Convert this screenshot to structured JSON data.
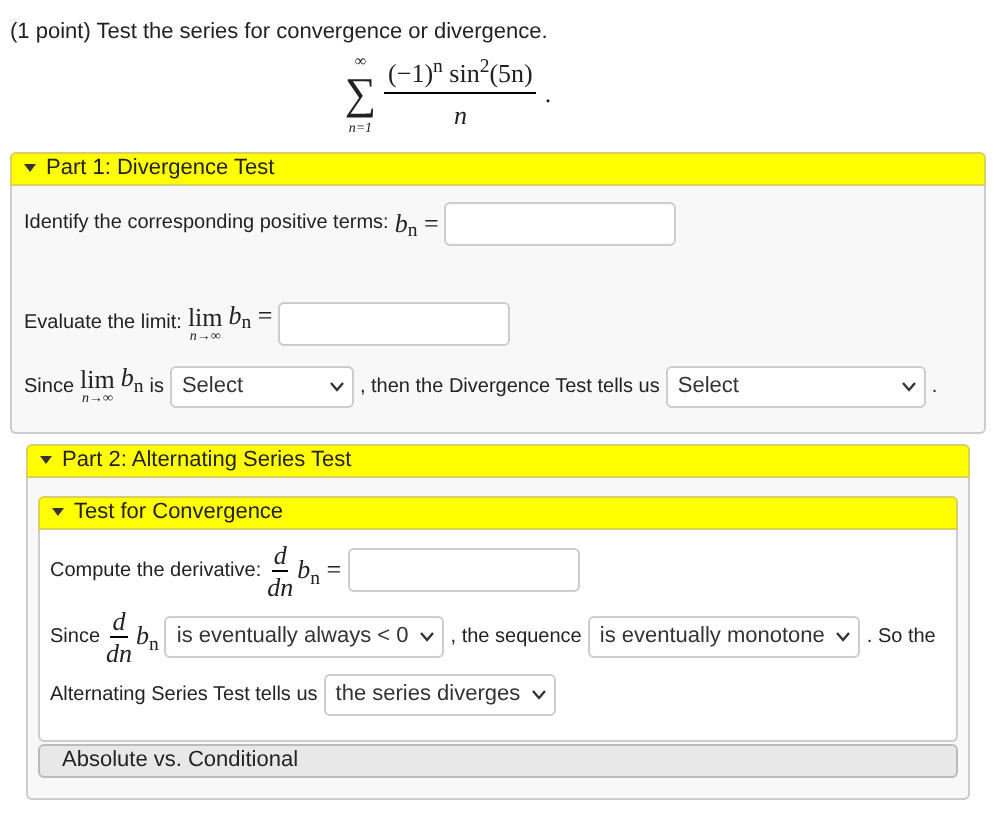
{
  "intro": "(1 point) Test the series for convergence or divergence.",
  "series": {
    "sum_top": "∞",
    "sum_sign": "∑",
    "sum_bottom": "n=1",
    "numerator": "(−1)$^{n}$ sin$^{2}$(5n)",
    "denominator": "*n*",
    "end": "."
  },
  "part1": {
    "title": "Part 1: Divergence Test",
    "expanded": true,
    "lines": [
      [
        {
          "kind": "text",
          "text": "Identify the corresponding positive terms:"
        },
        {
          "kind": "math",
          "text": "*b*$_{n}$ ="
        },
        {
          "kind": "field"
        }
      ],
      [
        {
          "kind": "text",
          "text": "Evaluate the limit:"
        },
        {
          "kind": "limit",
          "top": "lim",
          "bottom": "n→∞",
          "after": "*b*$_{n}$ ="
        },
        {
          "kind": "field"
        }
      ],
      [
        {
          "kind": "text",
          "text": "Since"
        },
        {
          "kind": "limit",
          "top": "lim",
          "bottom": "n→∞",
          "after": "*b*$_{n}$"
        },
        {
          "kind": "text",
          "text": "is"
        },
        {
          "kind": "select",
          "value": "Select"
        },
        {
          "kind": "text",
          "text": ", then the Divergence Test tells us"
        },
        {
          "kind": "select",
          "value": "Select"
        },
        {
          "kind": "text",
          "text": "."
        }
      ]
    ]
  },
  "part2": {
    "title": "Part 2: Alternating Series Test",
    "expanded": true,
    "sections": [
      {
        "title": "Test for Convergence",
        "expanded": true,
        "lines": [
          [
            {
              "kind": "text",
              "text": "Compute the derivative:"
            },
            {
              "kind": "frac",
              "num": "*d*",
              "den": "*dn*",
              "after": "*b*$_{n}$ ="
            },
            {
              "kind": "field"
            }
          ],
          [
            {
              "kind": "text",
              "text": "Since"
            },
            {
              "kind": "frac",
              "num": "*d*",
              "den": "*dn*",
              "after": "*b*$_{n}$"
            },
            {
              "kind": "select",
              "value": "is eventually always < 0"
            },
            {
              "kind": "text",
              "text": ", the sequence"
            },
            {
              "kind": "select",
              "value": "is eventually monotone"
            },
            {
              "kind": "text",
              "text": ". So the"
            }
          ],
          [
            {
              "kind": "text",
              "text": "Alternating Series Test tells us"
            },
            {
              "kind": "select",
              "value": "the series diverges"
            }
          ]
        ]
      },
      {
        "title": "Absolute vs. Conditional",
        "expanded": false
      }
    ]
  }
}
